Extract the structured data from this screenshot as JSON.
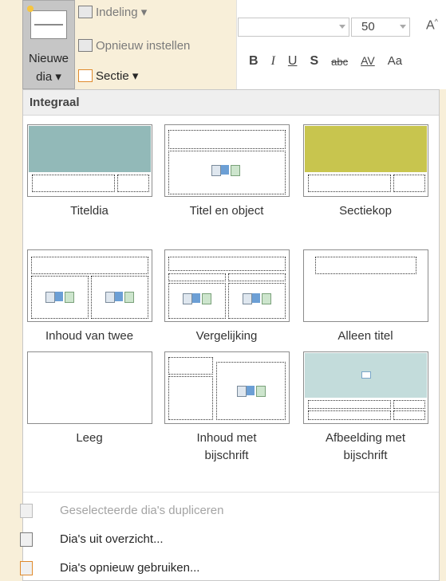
{
  "ribbon": {
    "new_slide": {
      "line1": "Nieuwe",
      "line2": "dia ▾"
    },
    "layout_label": "Indeling ▾",
    "reset_label": "Opnieuw instellen",
    "section_label": "Sectie ▾",
    "font_name_value": "",
    "font_size_value": "50",
    "grow_font_glyph": "A",
    "format": {
      "bold": "B",
      "italic": "I",
      "underline": "U",
      "shadow": "S",
      "strike": "abc",
      "spacing": "AV",
      "case": "Aa"
    }
  },
  "panel": {
    "header": "Integraal",
    "layouts": [
      {
        "label": "Titeldia",
        "accent": "#92b9b8"
      },
      {
        "label": "Titel en object"
      },
      {
        "label": "Sectiekop",
        "accent": "#c8c54e"
      },
      {
        "label": "Inhoud van twee"
      },
      {
        "label": "Vergelijking"
      },
      {
        "label": "Alleen titel"
      },
      {
        "label": "Leeg"
      },
      {
        "label": "Inhoud met\nbijschrift"
      },
      {
        "label": "Afbeelding met\nbijschrift",
        "accent": "#c3dcdb"
      }
    ],
    "menu": [
      {
        "label": "Geselecteerde dia's dupliceren",
        "disabled": true
      },
      {
        "label": "Dia's uit overzicht...",
        "disabled": false
      },
      {
        "label": "Dia's opnieuw gebruiken...",
        "disabled": false
      }
    ]
  }
}
